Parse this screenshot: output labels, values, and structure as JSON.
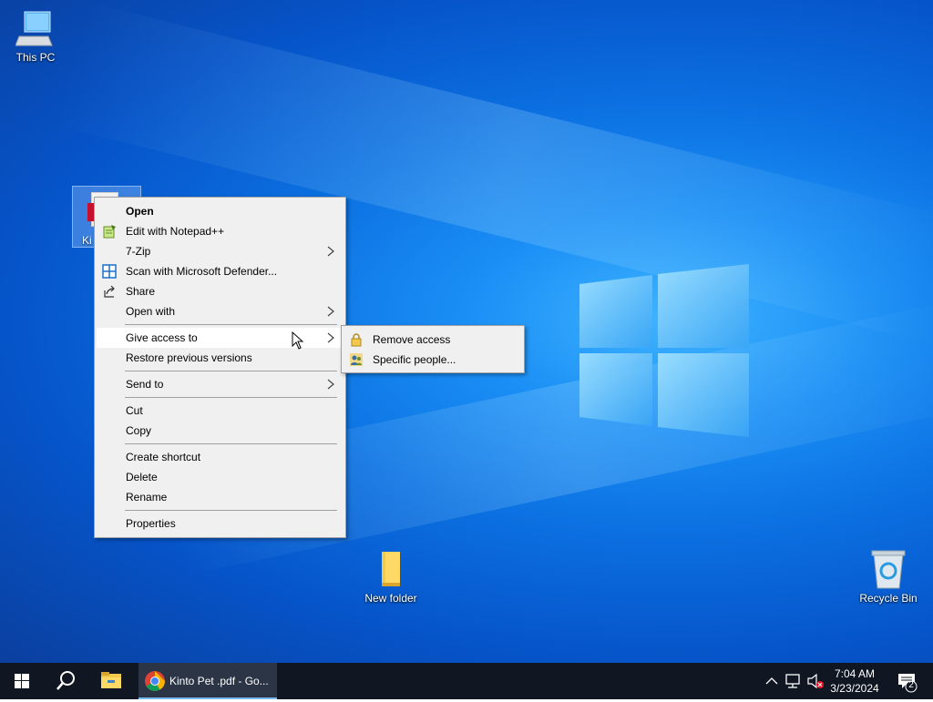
{
  "desktop": {
    "icons": {
      "this_pc": "This PC",
      "selected_file": "Ki",
      "new_folder": "New folder",
      "recycle_bin": "Recycle Bin"
    }
  },
  "context_menu": {
    "items": [
      {
        "label": "Open"
      },
      {
        "label": "Edit with Notepad++"
      },
      {
        "label": "7-Zip"
      },
      {
        "label": "Scan with Microsoft Defender..."
      },
      {
        "label": "Share"
      },
      {
        "label": "Open with"
      },
      {
        "label": "Give access to"
      },
      {
        "label": "Restore previous versions"
      },
      {
        "label": "Send to"
      },
      {
        "label": "Cut"
      },
      {
        "label": "Copy"
      },
      {
        "label": "Create shortcut"
      },
      {
        "label": "Delete"
      },
      {
        "label": "Rename"
      },
      {
        "label": "Properties"
      }
    ]
  },
  "submenu": {
    "items": [
      {
        "label": "Remove access"
      },
      {
        "label": "Specific people..."
      }
    ]
  },
  "taskbar": {
    "active_app_title": "Kinto Pet .pdf - Go...",
    "time": "7:04 AM",
    "date": "3/23/2024",
    "notification_count": "2"
  },
  "colors": {
    "desktop_blue": "#0b6fe0",
    "taskbar": "#101722",
    "menu_bg": "#f0f0f0",
    "menu_hover": "#ffffff"
  }
}
